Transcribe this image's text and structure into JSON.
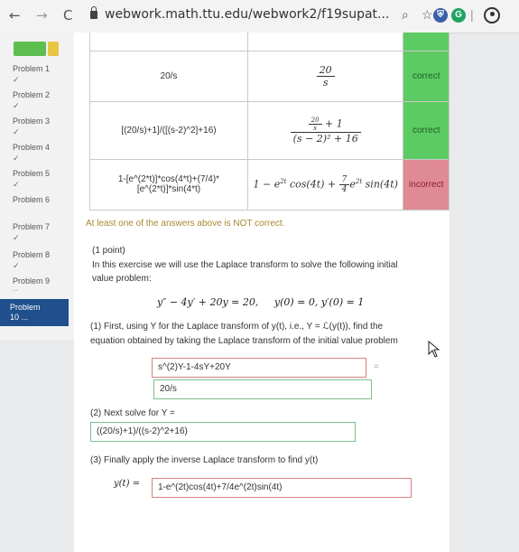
{
  "browser": {
    "url": "webwork.math.ttu.edu/webwork2/f19supat...",
    "back": "←",
    "forward": "→",
    "reload": "C",
    "zoom_glyph": "🔍",
    "star_glyph": "☆",
    "ext_g": "G"
  },
  "sidebar": {
    "items": [
      {
        "label": "Problem 1",
        "check": "✓"
      },
      {
        "label": "Problem 2",
        "check": "✓"
      },
      {
        "label": "Problem 3",
        "check": "✓"
      },
      {
        "label": "Problem 4",
        "check": "✓"
      },
      {
        "label": "Problem 5",
        "check": "✓"
      },
      {
        "label": "Problem 6",
        "check": ""
      },
      {
        "label": "Problem 7",
        "check": "✓"
      },
      {
        "label": "Problem 8",
        "check": "✓"
      },
      {
        "label": "Problem 9",
        "check": "..."
      },
      {
        "label": "Problem 10 ...",
        "check": ""
      }
    ],
    "active_line1": "Problem",
    "active_line2": "10 ..."
  },
  "results": {
    "rows": [
      {
        "entered": "20/s",
        "preview_num": "20",
        "preview_den": "s",
        "status": "correct"
      },
      {
        "entered": "[(20/s)+1]/([(s-2)^2]+16)",
        "preview": "(20/s + 1) / ((s − 2)² + 16)",
        "preview_small_num": "20",
        "preview_small_den": "s",
        "preview_plus": "+ 1",
        "preview_den": "(s − 2)² + 16",
        "status": "correct"
      },
      {
        "entered_line1": "1-[e^(2*t)]*cos(4*t)+(7/4)*",
        "entered_line2": "[e^(2*t)]*sin(4*t)",
        "preview": "1 − e^{2t} cos(4t) + 7/4 e^{2t} sin(4t)",
        "preview_a": "1 − e",
        "preview_b": " cos(4t) + ",
        "preview_frac_num": "7",
        "preview_frac_den": "4",
        "preview_c": "e",
        "preview_d": " sin(4t)",
        "preview_exp": "2t",
        "status": "incorrect"
      }
    ]
  },
  "warning": "At least one of the answers above is NOT correct.",
  "problem": {
    "points": "(1 point)",
    "intro_line1": "In this exercise we will use the Laplace transform to solve the following initial",
    "intro_line2": "value problem:",
    "equation": "y″ − 4y′ + 20y = 20,     y(0) = 0, y′(0) = 1",
    "part1_line1": "(1) First, using Y for the Laplace transform of y(t), i.e., Y = ℒ(y(t)), find the",
    "part1_line2": "equation obtained by taking the Laplace transform of the initial value problem",
    "answer1_left": "s^(2)Y-1-4sY+20Y",
    "equals": "=",
    "answer1_right": "20/s",
    "part2": "(2) Next solve for Y =",
    "answer2": "((20/s)+1)/((s-2)^2+16)",
    "part3": "(3) Finally apply the inverse Laplace transform to find y(t)",
    "yt_label": "y(t) =",
    "answer3": "1-e^(2t)cos(4t)+7/4e^(2t)sin(4t)"
  },
  "colors": {
    "correct": "#5dcb63",
    "incorrect": "#e08a96",
    "active": "#1f4f8c"
  }
}
